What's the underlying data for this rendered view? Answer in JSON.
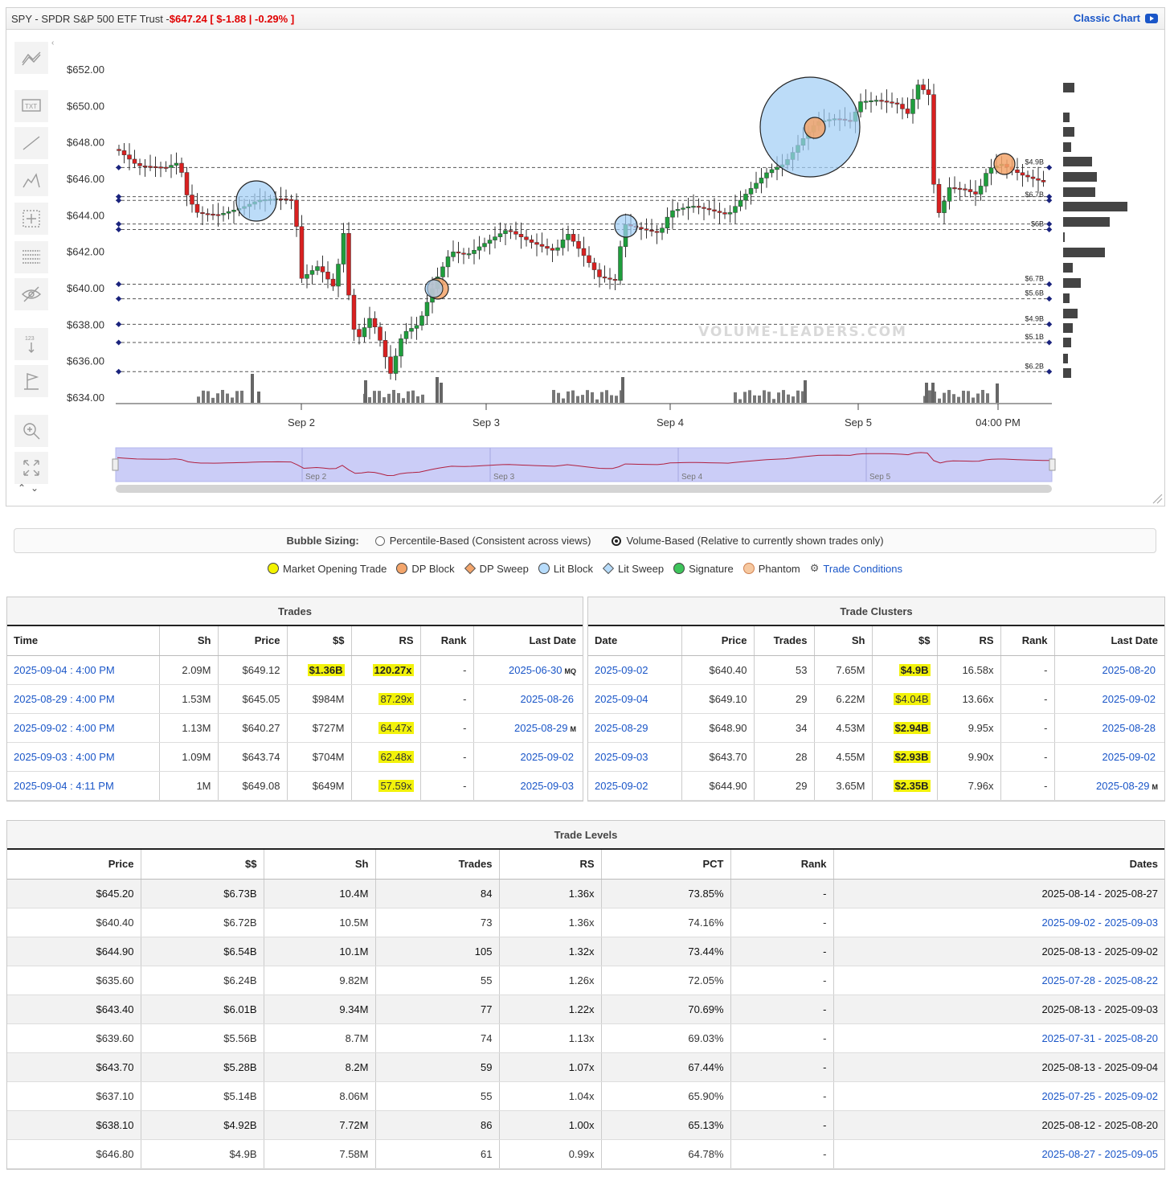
{
  "header": {
    "symbol": "SPY - SPDR S&P 500 ETF Trust - ",
    "price": "$647.24 [ $-1.88 | -0.29% ]",
    "classic": "Classic Chart"
  },
  "colors": {
    "up": "#1e9e3c",
    "down": "#d92020",
    "accent": "#1a56c8",
    "highlight": "#f2f20a"
  },
  "tools": [
    "trend-line-icon",
    "text-icon",
    "line-icon",
    "pattern-icon",
    "crosshair-icon",
    "grid-icon",
    "hide-icon",
    "price-marker-icon",
    "flag-icon",
    "zoom-icon",
    "fullscreen-icon"
  ],
  "chart_data": {
    "type": "candlestick",
    "y_axis": {
      "ticks": [
        "$652.00",
        "$650.00",
        "$648.00",
        "$646.00",
        "$644.00",
        "$642.00",
        "$640.00",
        "$638.00",
        "$636.00",
        "$634.00"
      ],
      "range": [
        634,
        652
      ]
    },
    "x_axis": {
      "labels": [
        "Sep 2",
        "Sep 3",
        "Sep 4",
        "Sep 5",
        "04:00 PM"
      ]
    },
    "watermark": "VOLUME-LEADERS.COM",
    "levels": [
      {
        "price": 646.6,
        "label": "$4.9B"
      },
      {
        "price": 645.0,
        "label": ""
      },
      {
        "price": 644.8,
        "label": "$6.7B"
      },
      {
        "price": 643.5,
        "label": ""
      },
      {
        "price": 643.2,
        "label": "$6B"
      },
      {
        "price": 640.2,
        "label": "$6.7B"
      },
      {
        "price": 639.4,
        "label": "$5.6B"
      },
      {
        "price": 638.0,
        "label": "$4.9B"
      },
      {
        "price": 637.0,
        "label": "$5.1B"
      },
      {
        "price": 635.4,
        "label": "$6.2B"
      }
    ],
    "bubbles": [
      {
        "type": "Lit Block",
        "price": 644.8
      },
      {
        "type": "DP Block",
        "price": 640.0
      },
      {
        "type": "Lit Block",
        "price": 643.6
      },
      {
        "type": "Lit Block",
        "price": 649.1
      },
      {
        "type": "DP Block",
        "price": 649.1
      },
      {
        "type": "DP Block",
        "price": 646.8
      }
    ],
    "navigator_labels": [
      "Sep 2",
      "Sep 3",
      "Sep 4",
      "Sep 5"
    ]
  },
  "sizing": {
    "label": "Bubble Sizing:",
    "option1": "Percentile-Based (Consistent across views)",
    "option2": "Volume-Based (Relative to currently shown trades only)"
  },
  "legend": {
    "market_open": "Market Opening Trade",
    "dp_block": "DP Block",
    "dp_sweep": "DP Sweep",
    "lit_block": "Lit Block",
    "lit_sweep": "Lit Sweep",
    "signature": "Signature",
    "phantom": "Phantom",
    "trade_conditions": "Trade Conditions"
  },
  "trades": {
    "title": "Trades",
    "headers": [
      "Time",
      "Sh",
      "Price",
      "$$",
      "RS",
      "Rank",
      "Last Date"
    ],
    "rows": [
      {
        "time": "2025-09-04 : 4:00 PM",
        "sh": "2.09M",
        "price": "$649.12",
        "dollars": "$1.36B",
        "rs": "120.27x",
        "rank": "-",
        "last": "2025-06-30",
        "suffix": "MQ"
      },
      {
        "time": "2025-08-29 : 4:00 PM",
        "sh": "1.53M",
        "price": "$645.05",
        "dollars": "$984M",
        "rs": "87.29x",
        "rank": "-",
        "last": "2025-08-26",
        "suffix": ""
      },
      {
        "time": "2025-09-02 : 4:00 PM",
        "sh": "1.13M",
        "price": "$640.27",
        "dollars": "$727M",
        "rs": "64.47x",
        "rank": "-",
        "last": "2025-08-29",
        "suffix": "M"
      },
      {
        "time": "2025-09-03 : 4:00 PM",
        "sh": "1.09M",
        "price": "$643.74",
        "dollars": "$704M",
        "rs": "62.48x",
        "rank": "-",
        "last": "2025-09-02",
        "suffix": ""
      },
      {
        "time": "2025-09-04 : 4:11 PM",
        "sh": "1M",
        "price": "$649.08",
        "dollars": "$649M",
        "rs": "57.59x",
        "rank": "-",
        "last": "2025-09-03",
        "suffix": ""
      }
    ]
  },
  "clusters": {
    "title": "Trade Clusters",
    "headers": [
      "Date",
      "Price",
      "Trades",
      "Sh",
      "$$",
      "RS",
      "Rank",
      "Last Date"
    ],
    "rows": [
      {
        "date": "2025-09-02",
        "price": "$640.40",
        "trades": "53",
        "sh": "7.65M",
        "dollars": "$4.9B",
        "rs": "16.58x",
        "rank": "-",
        "last": "2025-08-20",
        "suffix": ""
      },
      {
        "date": "2025-09-04",
        "price": "$649.10",
        "trades": "29",
        "sh": "6.22M",
        "dollars": "$4.04B",
        "rs": "13.66x",
        "rank": "-",
        "last": "2025-09-02",
        "suffix": ""
      },
      {
        "date": "2025-08-29",
        "price": "$648.90",
        "trades": "34",
        "sh": "4.53M",
        "dollars": "$2.94B",
        "rs": "9.95x",
        "rank": "-",
        "last": "2025-08-28",
        "suffix": ""
      },
      {
        "date": "2025-09-03",
        "price": "$643.70",
        "trades": "28",
        "sh": "4.55M",
        "dollars": "$2.93B",
        "rs": "9.90x",
        "rank": "-",
        "last": "2025-09-02",
        "suffix": ""
      },
      {
        "date": "2025-09-02",
        "price": "$644.90",
        "trades": "29",
        "sh": "3.65M",
        "dollars": "$2.35B",
        "rs": "7.96x",
        "rank": "-",
        "last": "2025-08-29",
        "suffix": "M"
      }
    ]
  },
  "levels_table": {
    "title": "Trade Levels",
    "headers": [
      "Price",
      "$$",
      "Sh",
      "Trades",
      "RS",
      "PCT",
      "Rank",
      "Dates"
    ],
    "rows": [
      {
        "price": "$645.20",
        "dollars": "$6.73B",
        "sh": "10.4M",
        "trades": "84",
        "rs": "1.36x",
        "pct": "73.85%",
        "rank": "-",
        "dates": "2025-08-14 - 2025-08-27"
      },
      {
        "price": "$640.40",
        "dollars": "$6.72B",
        "sh": "10.5M",
        "trades": "73",
        "rs": "1.36x",
        "pct": "74.16%",
        "rank": "-",
        "dates": "2025-09-02 - 2025-09-03"
      },
      {
        "price": "$644.90",
        "dollars": "$6.54B",
        "sh": "10.1M",
        "trades": "105",
        "rs": "1.32x",
        "pct": "73.44%",
        "rank": "-",
        "dates": "2025-08-13 - 2025-09-02"
      },
      {
        "price": "$635.60",
        "dollars": "$6.24B",
        "sh": "9.82M",
        "trades": "55",
        "rs": "1.26x",
        "pct": "72.05%",
        "rank": "-",
        "dates": "2025-07-28 - 2025-08-22"
      },
      {
        "price": "$643.40",
        "dollars": "$6.01B",
        "sh": "9.34M",
        "trades": "77",
        "rs": "1.22x",
        "pct": "70.69%",
        "rank": "-",
        "dates": "2025-08-13 - 2025-09-03"
      },
      {
        "price": "$639.60",
        "dollars": "$5.56B",
        "sh": "8.7M",
        "trades": "74",
        "rs": "1.13x",
        "pct": "69.03%",
        "rank": "-",
        "dates": "2025-07-31 - 2025-08-20"
      },
      {
        "price": "$643.70",
        "dollars": "$5.28B",
        "sh": "8.2M",
        "trades": "59",
        "rs": "1.07x",
        "pct": "67.44%",
        "rank": "-",
        "dates": "2025-08-13 - 2025-09-04"
      },
      {
        "price": "$637.10",
        "dollars": "$5.14B",
        "sh": "8.06M",
        "trades": "55",
        "rs": "1.04x",
        "pct": "65.90%",
        "rank": "-",
        "dates": "2025-07-25 - 2025-09-02"
      },
      {
        "price": "$638.10",
        "dollars": "$4.92B",
        "sh": "7.72M",
        "trades": "86",
        "rs": "1.00x",
        "pct": "65.13%",
        "rank": "-",
        "dates": "2025-08-12 - 2025-08-20"
      },
      {
        "price": "$646.80",
        "dollars": "$4.9B",
        "sh": "7.58M",
        "trades": "61",
        "rs": "0.99x",
        "pct": "64.78%",
        "rank": "-",
        "dates": "2025-08-27 - 2025-09-05"
      }
    ]
  }
}
